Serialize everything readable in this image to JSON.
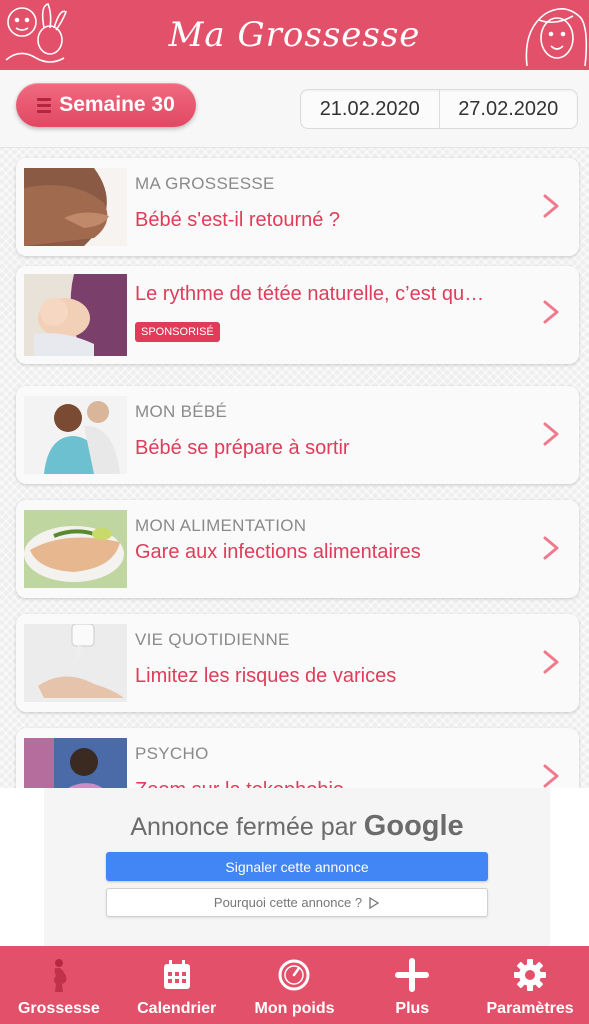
{
  "app": {
    "title": "Ma Grossesse",
    "accent": "#e3506a"
  },
  "toolbar": {
    "week_label": "Semaine 30",
    "date_start": "21.02.2020",
    "date_end": "27.02.2020"
  },
  "cards": [
    {
      "category": "MA GROSSESSE",
      "title": "Bébé s'est-il retourné ?",
      "thumb": "pregnant-belly-photo"
    },
    {
      "category": "",
      "title": "Le rythme de tétée naturelle, c’est qu…",
      "badge": "SPONSORISÉ",
      "thumb": "breastfeeding-photo"
    },
    {
      "category": "MON BÉBÉ",
      "title": "Bébé se prépare à sortir",
      "thumb": "couple-ultrasound-photo"
    },
    {
      "category": "MON ALIMENTATION",
      "title": "Gare aux infections alimentaires",
      "thumb": "fish-dish-photo"
    },
    {
      "category": "VIE QUOTIDIENNE",
      "title": "Limitez les risques de varices",
      "thumb": "cream-hand-photo"
    },
    {
      "category": "PSYCHO",
      "title": "Zoom sur la tokophobie",
      "thumb": "anxious-woman-photo"
    }
  ],
  "ad": {
    "closed_text": "Annonce fermée par",
    "brand": "Google",
    "report_label": "Signaler cette annonce",
    "why_label": "Pourquoi cette annonce ?"
  },
  "nav": [
    {
      "label": "Grossesse",
      "icon": "pregnant-woman-icon"
    },
    {
      "label": "Calendrier",
      "icon": "calendar-icon"
    },
    {
      "label": "Mon poids",
      "icon": "scale-icon"
    },
    {
      "label": "Plus",
      "icon": "plus-icon"
    },
    {
      "label": "Paramètres",
      "icon": "gear-icon"
    }
  ]
}
